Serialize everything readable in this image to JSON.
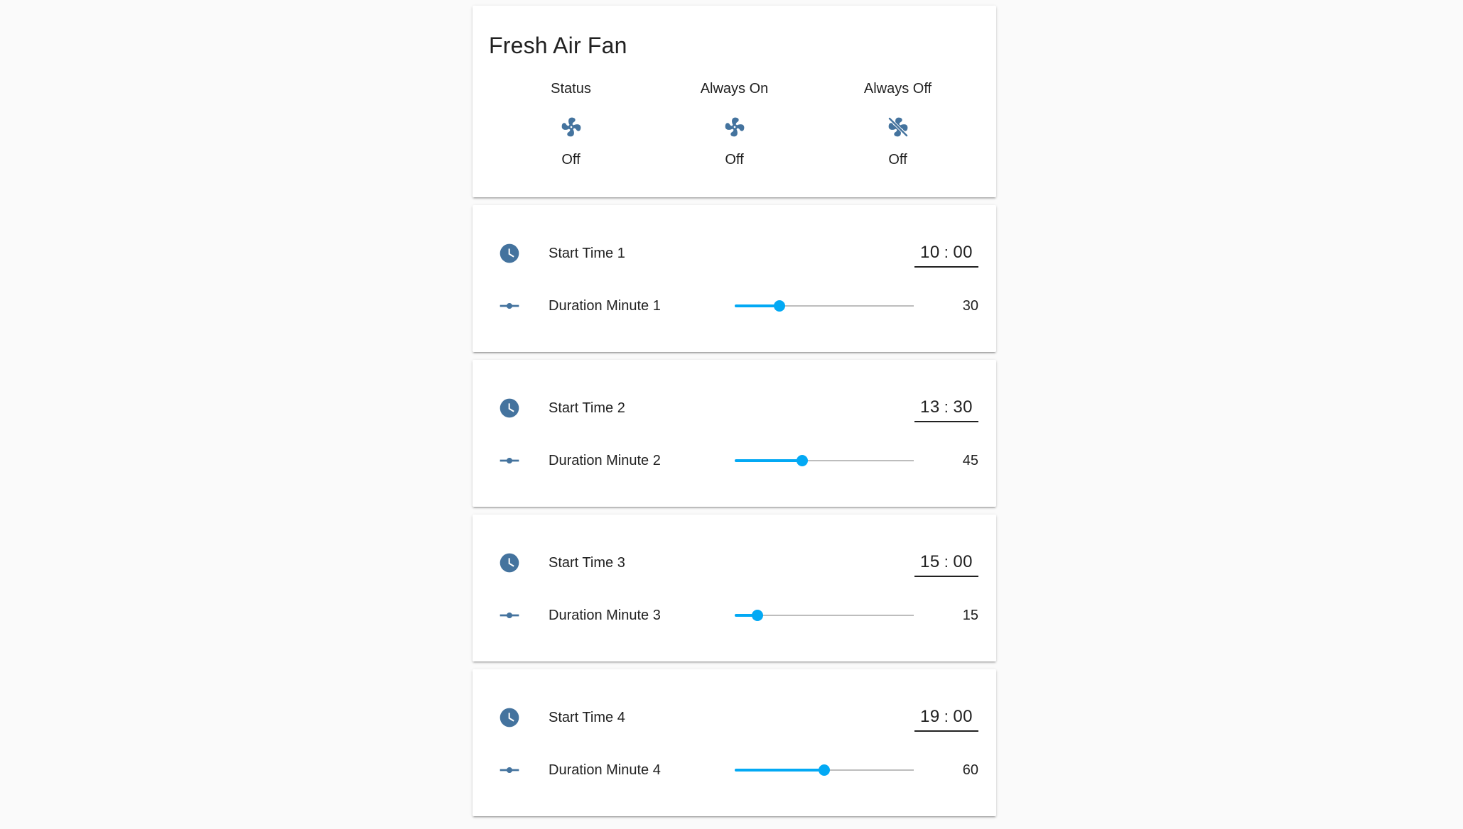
{
  "card": {
    "title": "Fresh Air Fan",
    "glance": [
      {
        "name": "Status",
        "state": "Off",
        "icon": "fan-icon"
      },
      {
        "name": "Always On",
        "state": "Off",
        "icon": "fan-icon"
      },
      {
        "name": "Always Off",
        "state": "Off",
        "icon": "fan-off-icon"
      }
    ]
  },
  "schedules": [
    {
      "time_label": "Start Time 1",
      "hour": "10",
      "minute": "00",
      "duration_label": "Duration Minute 1",
      "duration": "30",
      "duration_fraction": 0.25
    },
    {
      "time_label": "Start Time 2",
      "hour": "13",
      "minute": "30",
      "duration_label": "Duration Minute 2",
      "duration": "45",
      "duration_fraction": 0.375
    },
    {
      "time_label": "Start Time 3",
      "hour": "15",
      "minute": "00",
      "duration_label": "Duration Minute 3",
      "duration": "15",
      "duration_fraction": 0.125
    },
    {
      "time_label": "Start Time 4",
      "hour": "19",
      "minute": "00",
      "duration_label": "Duration Minute 4",
      "duration": "60",
      "duration_fraction": 0.5
    }
  ],
  "time_separator": ":",
  "icons": {
    "clock": "clock-icon",
    "slider": "ray-vertex-icon"
  },
  "colors": {
    "icon": "#44739e",
    "accent": "#03a9f4",
    "track": "#bdbdbd",
    "background": "#fafafa"
  }
}
